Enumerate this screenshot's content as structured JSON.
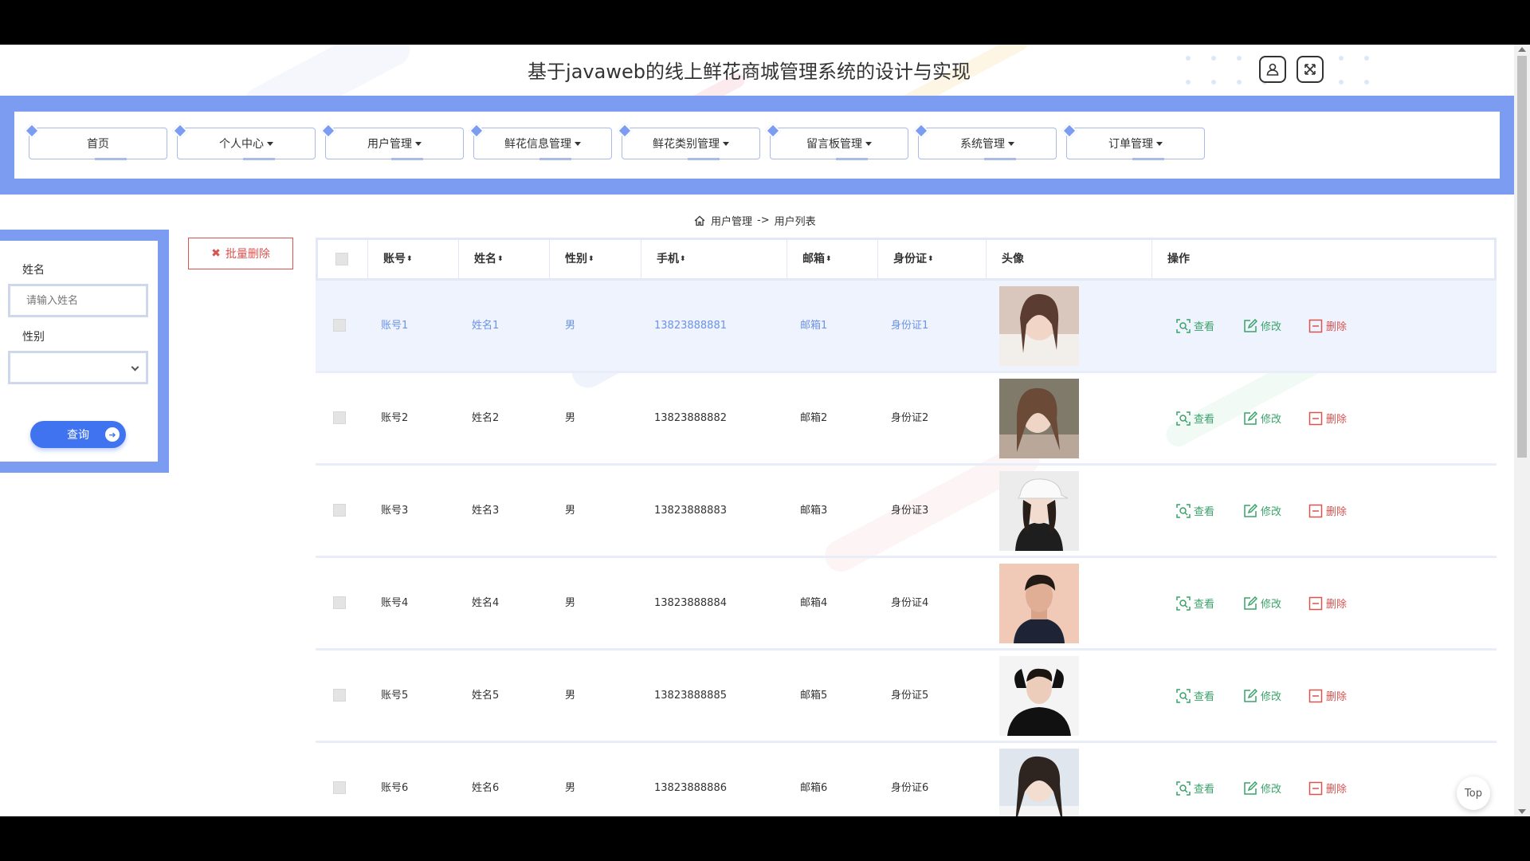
{
  "header": {
    "title": "基于javaweb的线上鲜花商城管理系统的设计与实现",
    "user_icon": "user-icon",
    "fullscreen_icon": "fullscreen-icon"
  },
  "nav": {
    "items": [
      {
        "label": "首页",
        "dropdown": false
      },
      {
        "label": "个人中心",
        "dropdown": true
      },
      {
        "label": "用户管理",
        "dropdown": true
      },
      {
        "label": "鲜花信息管理",
        "dropdown": true
      },
      {
        "label": "鲜花类别管理",
        "dropdown": true
      },
      {
        "label": "留言板管理",
        "dropdown": true
      },
      {
        "label": "系统管理",
        "dropdown": true
      },
      {
        "label": "订单管理",
        "dropdown": true
      }
    ]
  },
  "breadcrumb": {
    "home_icon": "home-icon",
    "parent": "用户管理",
    "separator": "->",
    "current": "用户列表"
  },
  "search": {
    "name_label": "姓名",
    "name_placeholder": "请输入姓名",
    "gender_label": "性别",
    "gender_value": "",
    "query_label": "查询"
  },
  "toolbar": {
    "batch_delete_label": "批量删除"
  },
  "table": {
    "columns": [
      "账号",
      "姓名",
      "性别",
      "手机",
      "邮箱",
      "身份证",
      "头像",
      "操作"
    ],
    "sortable": [
      "账号",
      "姓名",
      "性别",
      "手机",
      "邮箱",
      "身份证"
    ],
    "actions": {
      "view": "查看",
      "edit": "修改",
      "delete": "删除"
    },
    "rows": [
      {
        "account": "账号1",
        "name": "姓名1",
        "gender": "男",
        "phone": "13823888881",
        "email": "邮箱1",
        "idcard": "身份证1"
      },
      {
        "account": "账号2",
        "name": "姓名2",
        "gender": "男",
        "phone": "13823888882",
        "email": "邮箱2",
        "idcard": "身份证2"
      },
      {
        "account": "账号3",
        "name": "姓名3",
        "gender": "男",
        "phone": "13823888883",
        "email": "邮箱3",
        "idcard": "身份证3"
      },
      {
        "account": "账号4",
        "name": "姓名4",
        "gender": "男",
        "phone": "13823888884",
        "email": "邮箱4",
        "idcard": "身份证4"
      },
      {
        "account": "账号5",
        "name": "姓名5",
        "gender": "男",
        "phone": "13823888885",
        "email": "邮箱5",
        "idcard": "身份证5"
      },
      {
        "account": "账号6",
        "name": "姓名6",
        "gender": "男",
        "phone": "13823888886",
        "email": "邮箱6",
        "idcard": "身份证6"
      }
    ]
  },
  "back_to_top": "Top",
  "colors": {
    "accent": "#7b9cf0",
    "primary_button": "#3f73f0",
    "action_green": "#3aa36a",
    "action_red": "#d9534f",
    "highlight_row": "#eef3fd"
  }
}
